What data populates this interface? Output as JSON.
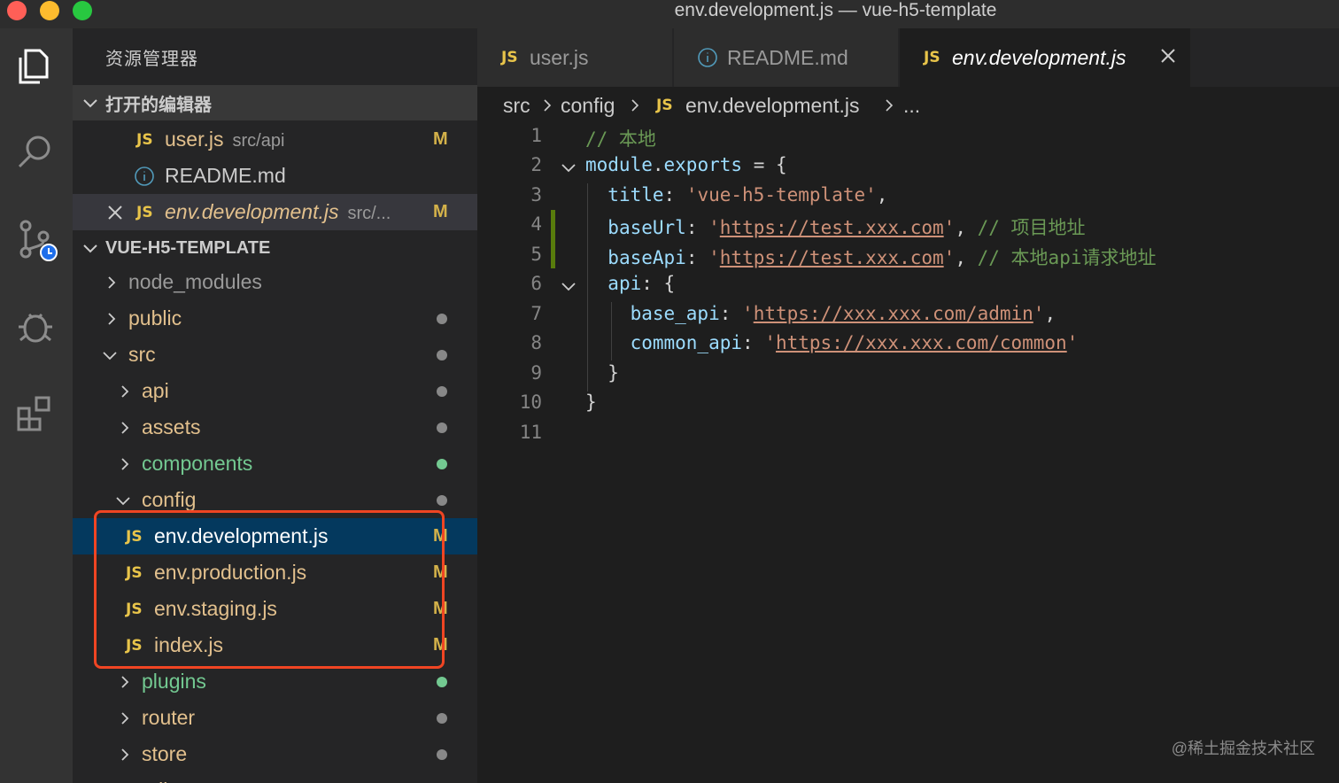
{
  "window": {
    "title": "env.development.js — vue-h5-template"
  },
  "sidebar": {
    "title": "资源管理器",
    "open_editors": {
      "label": "打开的编辑器",
      "items": [
        {
          "icon": "JS",
          "name": "user.js",
          "path": "src/api",
          "badge": "M"
        },
        {
          "icon": "info-icon",
          "name": "README.md",
          "path": "",
          "badge": ""
        },
        {
          "icon": "JS",
          "name": "env.development.js",
          "path": "src/...",
          "badge": "M"
        }
      ]
    },
    "project": {
      "label": "VUE-H5-TEMPLATE",
      "tree": [
        {
          "name": "node_modules",
          "color": "#9a9a9a"
        },
        {
          "name": "public",
          "color": "#e2c08d"
        },
        {
          "name": "src",
          "color": "#e2c08d"
        },
        {
          "name": "api",
          "color": "#e2c08d"
        },
        {
          "name": "assets",
          "color": "#e2c08d"
        },
        {
          "name": "components",
          "color": "#73c991"
        },
        {
          "name": "config",
          "color": "#e2c08d"
        },
        {
          "icon": "JS",
          "name": "env.development.js",
          "badge": "M",
          "color": "#e2c08d"
        },
        {
          "icon": "JS",
          "name": "env.production.js",
          "badge": "M",
          "color": "#e2c08d"
        },
        {
          "icon": "JS",
          "name": "env.staging.js",
          "badge": "M",
          "color": "#e2c08d"
        },
        {
          "icon": "JS",
          "name": "index.js",
          "badge": "M",
          "color": "#e2c08d"
        },
        {
          "name": "plugins",
          "color": "#73c991"
        },
        {
          "name": "router",
          "color": "#e2c08d"
        },
        {
          "name": "store",
          "color": "#e2c08d"
        },
        {
          "name": "utils",
          "color": "#e2c08d"
        }
      ]
    }
  },
  "tabs": [
    {
      "icon": "JS",
      "label": "user.js"
    },
    {
      "icon": "info-icon",
      "label": "README.md"
    },
    {
      "icon": "JS",
      "label": "env.development.js",
      "active": true
    }
  ],
  "breadcrumb": [
    "src",
    "config",
    "JS",
    "env.development.js",
    "..."
  ],
  "code": {
    "line_numbers": [
      "1",
      "2",
      "3",
      "4",
      "5",
      "6",
      "7",
      "8",
      "9",
      "10",
      "11"
    ],
    "lines": [
      "// 本地",
      "module.exports = {",
      "  title: 'vue-h5-template',",
      "  baseUrl: 'https://test.xxx.com', // 项目地址",
      "  baseApi: 'https://test.xxx.com', // 本地api请求地址",
      "  api: {",
      "    base_api: 'https://xxx.xxx.com/admin',",
      "    common_api: 'https://xxx.xxx.com/common'",
      "  }",
      "}",
      ""
    ]
  },
  "watermark": "@稀土掘金技术社区",
  "colors": {
    "selection": "#04395e",
    "highlight_box": "#f04523",
    "modified": "#e2c08d",
    "untracked": "#73c991"
  }
}
